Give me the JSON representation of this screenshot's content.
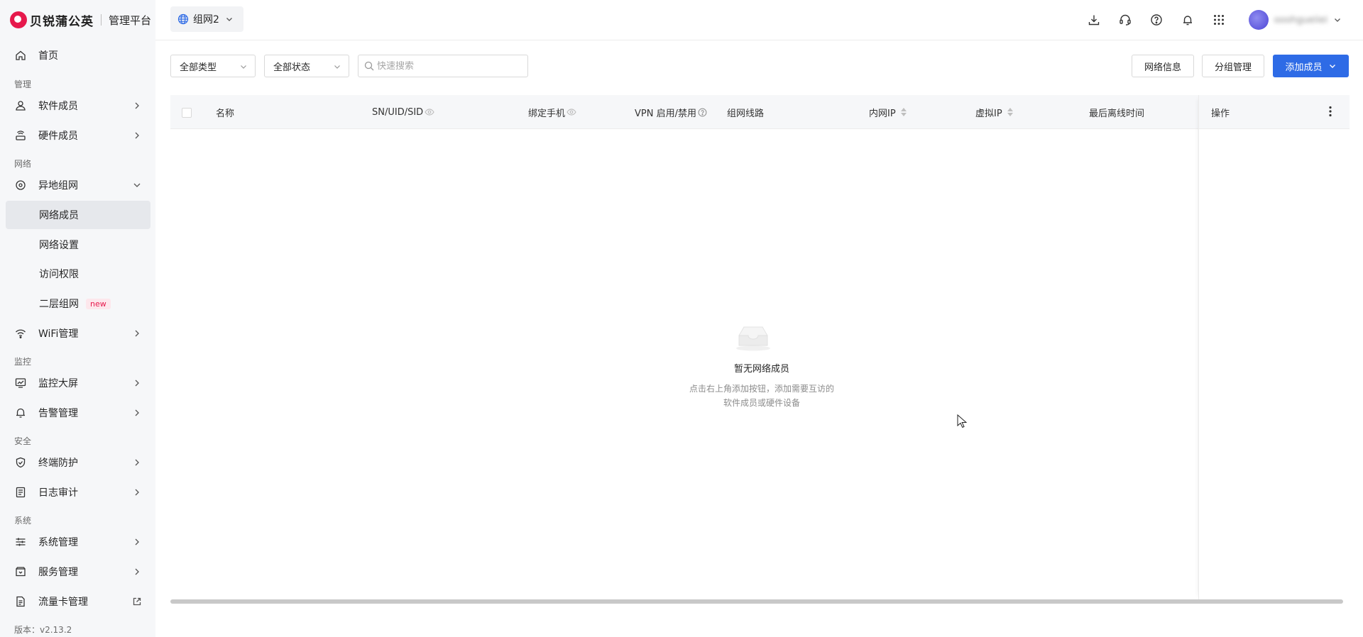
{
  "brand": {
    "name": "贝锐蒲公英",
    "subtitle": "管理平台"
  },
  "sidebar": {
    "home": "首页",
    "sections": {
      "manage": "管理",
      "network": "网络",
      "monitor": "监控",
      "security": "安全",
      "system": "系统"
    },
    "items": {
      "software_members": "软件成员",
      "hardware_members": "硬件成员",
      "remote_network": "异地组网",
      "network_members": "网络成员",
      "network_settings": "网络设置",
      "access_control": "访问权限",
      "layer2_network": "二层组网",
      "layer2_badge": "new",
      "wifi_management": "WiFi管理",
      "monitor_screen": "监控大屏",
      "alert_management": "告警管理",
      "endpoint_protection": "终端防护",
      "log_audit": "日志审计",
      "system_management": "系统管理",
      "service_management": "服务管理",
      "data_card_management": "流量卡管理"
    },
    "version": "版本：v2.13.2"
  },
  "header": {
    "network_selector": "组网2",
    "user_name": "ooohgueiiei"
  },
  "toolbar": {
    "type_filter": "全部类型",
    "status_filter": "全部状态",
    "search_placeholder": "快速搜索",
    "network_info": "网络信息",
    "group_management": "分组管理",
    "add_member": "添加成员"
  },
  "table": {
    "columns": {
      "name": "名称",
      "sn_uid_sid": "SN/UID/SID",
      "bound_phone": "绑定手机",
      "vpn": "VPN 启用/禁用",
      "route": "组网线路",
      "lan_ip": "内网IP",
      "virtual_ip": "虚拟IP",
      "last_offline": "最后离线时间",
      "actions": "操作"
    }
  },
  "empty_state": {
    "title": "暂无网络成员",
    "desc_line1": "点击右上角添加按钮，添加需要互访的",
    "desc_line2": "软件成员或硬件设备"
  }
}
